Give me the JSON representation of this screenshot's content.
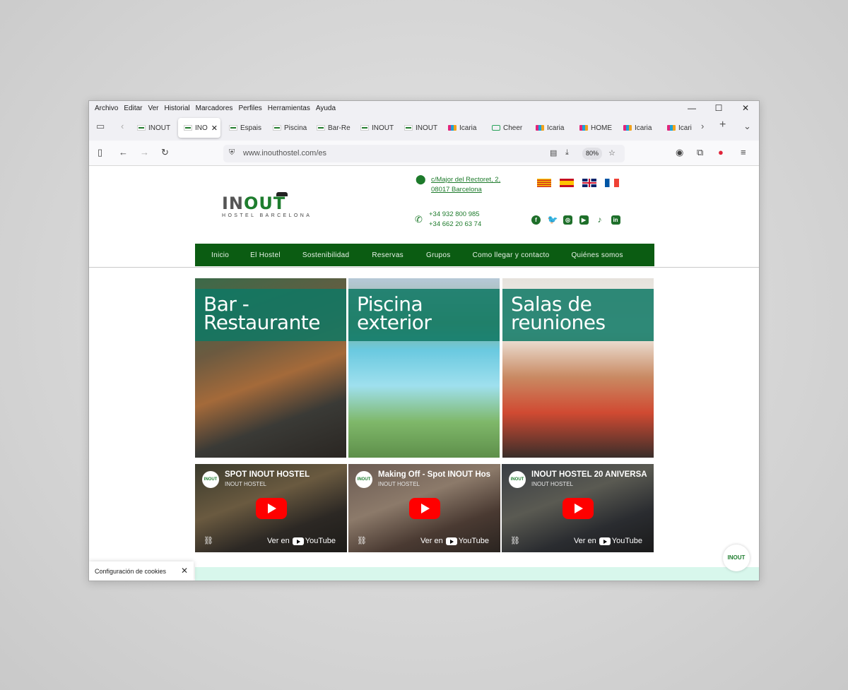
{
  "menubar": {
    "items": [
      "Archivo",
      "Editar",
      "Ver",
      "Historial",
      "Marcadores",
      "Perfiles",
      "Herramientas",
      "Ayuda"
    ]
  },
  "window_controls": {
    "minimize": "—",
    "maximize": "☐",
    "close": "✕"
  },
  "tabs": [
    {
      "label": "INOUT",
      "favicon": "inout-favicon"
    },
    {
      "label": "INO",
      "favicon": "inout-favicon",
      "active": true
    },
    {
      "label": "Espais",
      "favicon": "inout-favicon"
    },
    {
      "label": "Piscina",
      "favicon": "inout-favicon"
    },
    {
      "label": "Bar-Re",
      "favicon": "inout-favicon"
    },
    {
      "label": "INOUT",
      "favicon": "inout-favicon"
    },
    {
      "label": "INOUT",
      "favicon": "inout-favicon"
    },
    {
      "label": "Icaria",
      "favicon": "icaria-favicon"
    },
    {
      "label": "Cheer",
      "favicon": "cheer-favicon"
    },
    {
      "label": "Icaria",
      "favicon": "icaria-favicon"
    },
    {
      "label": "HOME",
      "favicon": "icaria-favicon"
    },
    {
      "label": "Icaria",
      "favicon": "icaria-favicon"
    },
    {
      "label": "Icari",
      "favicon": "icaria-favicon"
    }
  ],
  "toolbar": {
    "url": "www.inouthostel.com/es",
    "zoom": "80%"
  },
  "site": {
    "logo": {
      "in": "IN",
      "out": "OUT",
      "sub": "HOSTEL BARCELONA"
    },
    "address": {
      "line1": "c/Major del Rectoret, 2,",
      "line2": "08017 Barcelona"
    },
    "phones": {
      "line1": "+34 932 800 985",
      "line2": "+34 662 20 63 74"
    },
    "languages": [
      "ca",
      "es",
      "en",
      "fr"
    ],
    "social": [
      "facebook-icon",
      "twitter-icon",
      "instagram-icon",
      "youtube-icon",
      "tiktok-icon",
      "linkedin-icon"
    ],
    "nav": [
      "Inicio",
      "El Hostel",
      "Sostenibilidad",
      "Reservas",
      "Grupos",
      "Como llegar y contacto",
      "Quiénes somos"
    ],
    "cards": [
      {
        "line1": "Bar -",
        "line2": "Restaurante"
      },
      {
        "line1": "Piscina",
        "line2": "exterior"
      },
      {
        "line1": "Salas de",
        "line2": "reuniones"
      }
    ],
    "videos": [
      {
        "title": "SPOT INOUT HOSTEL",
        "channel": "INOUT HOSTEL",
        "watch": "Ver en",
        "yt": "YouTube"
      },
      {
        "title": "Making Off - Spot INOUT Hos",
        "channel": "INOUT HOSTEL",
        "watch": "Ver en",
        "yt": "YouTube"
      },
      {
        "title": "INOUT HOSTEL 20 ANIVERSA",
        "channel": "INOUT HOSTEL",
        "watch": "Ver en",
        "yt": "YouTube"
      }
    ],
    "cookie_label": "Configuración de cookies",
    "floating_logo": "INOUT"
  },
  "colors": {
    "brand_green": "#0b5c12",
    "accent_green": "#1d7a2b",
    "overlay_teal": "#0e7864"
  }
}
